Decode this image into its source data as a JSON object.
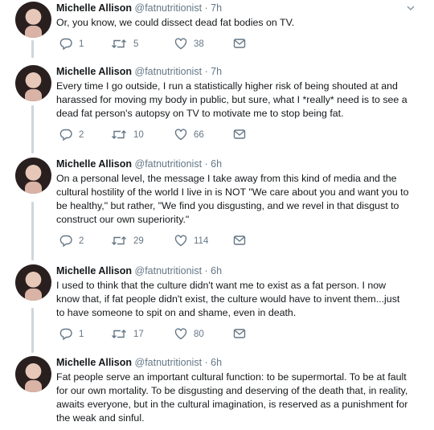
{
  "tweets": [
    {
      "name": "Michelle Allison",
      "handle": "@fatnutritionist",
      "time": "· 7h",
      "text": "Or, you know, we could dissect dead fat bodies on TV.",
      "replies": "1",
      "retweets": "5",
      "likes": "38"
    },
    {
      "name": "Michelle Allison",
      "handle": "@fatnutritionist",
      "time": "· 7h",
      "text": "Every time I go outside, I run a statistically higher risk of being shouted at and harassed for moving my body in public, but sure, what I *really* need is to see a dead fat person's autopsy on TV to motivate me to stop being fat.",
      "replies": "2",
      "retweets": "10",
      "likes": "66"
    },
    {
      "name": "Michelle Allison",
      "handle": "@fatnutritionist",
      "time": "· 6h",
      "text": "On a personal level, the message I take away from this kind of media and the cultural hostility of the world I live in is NOT \"We care about you and want you to be healthy,\" but rather, \"We find you disgusting, and we revel in that disgust to construct our own superiority.\"",
      "replies": "2",
      "retweets": "29",
      "likes": "114"
    },
    {
      "name": "Michelle Allison",
      "handle": "@fatnutritionist",
      "time": "· 6h",
      "text": "I used to think that the culture didn't want me to exist as a fat person. I now know that, if fat people didn't exist, the culture would have to invent them...just to have someone to spit on and shame, even in death.",
      "replies": "1",
      "retweets": "17",
      "likes": "80"
    },
    {
      "name": "Michelle Allison",
      "handle": "@fatnutritionist",
      "time": "· 6h",
      "text": "Fat people serve an important cultural function: to be supermortal. To be at fault for our own mortality. To be disgusting and deserving of the death that, in reality, awaits everyone, but in the cultural imagination, is reserved as a punishment for the weak and sinful."
    }
  ],
  "icons": {
    "reply": "reply-icon",
    "retweet": "retweet-icon",
    "like": "heart-icon",
    "dm": "envelope-icon",
    "caret": "chevron-down-icon"
  },
  "colors": {
    "icon": "#657786",
    "thread_line": "#ccd6dd",
    "divider": "#e6ecf0"
  }
}
